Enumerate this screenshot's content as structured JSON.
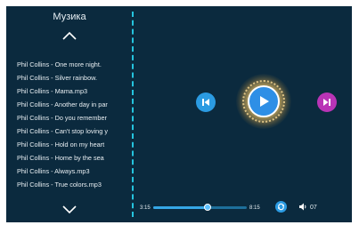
{
  "header": {
    "title": "Музика"
  },
  "playlist": [
    "Phil Collins - One more night.",
    "Phil Collins - Silver rainbow.",
    "Phil Collins - Mama.mp3",
    "Phil Collins - Another day in par",
    "Phil Collins - Do you remember",
    "Phil Collins - Can't stop loving y",
    "Phil Collins - Hold on my heart",
    "Phil Collins - Home by the sea",
    "Phil Collins - Always.mp3",
    "Phil Collins - True colors.mp3"
  ],
  "player": {
    "current_time": "3:15",
    "total_time": "8:15",
    "progress": 0.58,
    "volume": "07"
  },
  "icons": {
    "scroll_up": "chevron-up-icon",
    "scroll_down": "chevron-down-icon",
    "prev": "skip-previous-icon",
    "play": "play-icon",
    "next": "skip-next-icon",
    "repeat": "repeat-icon",
    "volume": "volume-icon"
  },
  "colors": {
    "background": "#0b2a3e",
    "accent": "#2b9be2",
    "divider": "#25c4de",
    "next_button": "#b934b6",
    "glow": "#ffd278"
  }
}
